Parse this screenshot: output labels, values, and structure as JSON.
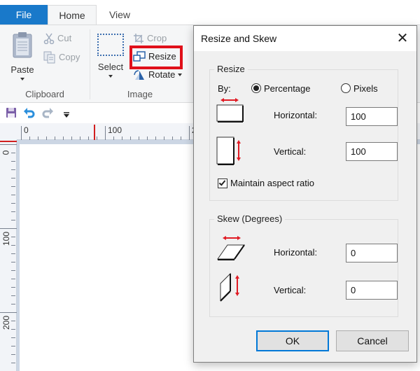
{
  "ribbon": {
    "tabs": [
      {
        "label": "File",
        "active": false
      },
      {
        "label": "Home",
        "active": true
      },
      {
        "label": "View",
        "active": false
      }
    ],
    "groups": {
      "clipboard": {
        "label": "Clipboard",
        "paste_label": "Paste",
        "cut_label": "Cut",
        "copy_label": "Copy"
      },
      "image": {
        "label": "Image",
        "select_label": "Select",
        "crop_label": "Crop",
        "resize_label": "Resize",
        "rotate_label": "Rotate"
      }
    },
    "highlight_color": "#e0101a"
  },
  "quick_access": {
    "items": [
      "save-icon",
      "undo-icon",
      "redo-icon",
      "customize-icon"
    ]
  },
  "rulers": {
    "horizontal_labels": [
      "0",
      "100",
      "2"
    ],
    "vertical_labels": [
      "0",
      "100",
      "200"
    ]
  },
  "dialog": {
    "title": "Resize and Skew",
    "close_icon": "✕",
    "resize": {
      "legend": "Resize",
      "by_label": "By:",
      "options": [
        {
          "label": "Percentage",
          "checked": true
        },
        {
          "label": "Pixels",
          "checked": false
        }
      ],
      "horizontal_label": "Horizontal:",
      "horizontal_value": "100",
      "vertical_label": "Vertical:",
      "vertical_value": "100",
      "maintain_aspect_label": "Maintain aspect ratio",
      "maintain_aspect_checked": true
    },
    "skew": {
      "legend": "Skew (Degrees)",
      "horizontal_label": "Horizontal:",
      "horizontal_value": "0",
      "vertical_label": "Vertical:",
      "vertical_value": "0"
    },
    "ok_label": "OK",
    "cancel_label": "Cancel"
  },
  "colors": {
    "file_tab": "#1979ca",
    "accent_arrow": "#e01b24",
    "default_button_border": "#0078d7"
  }
}
